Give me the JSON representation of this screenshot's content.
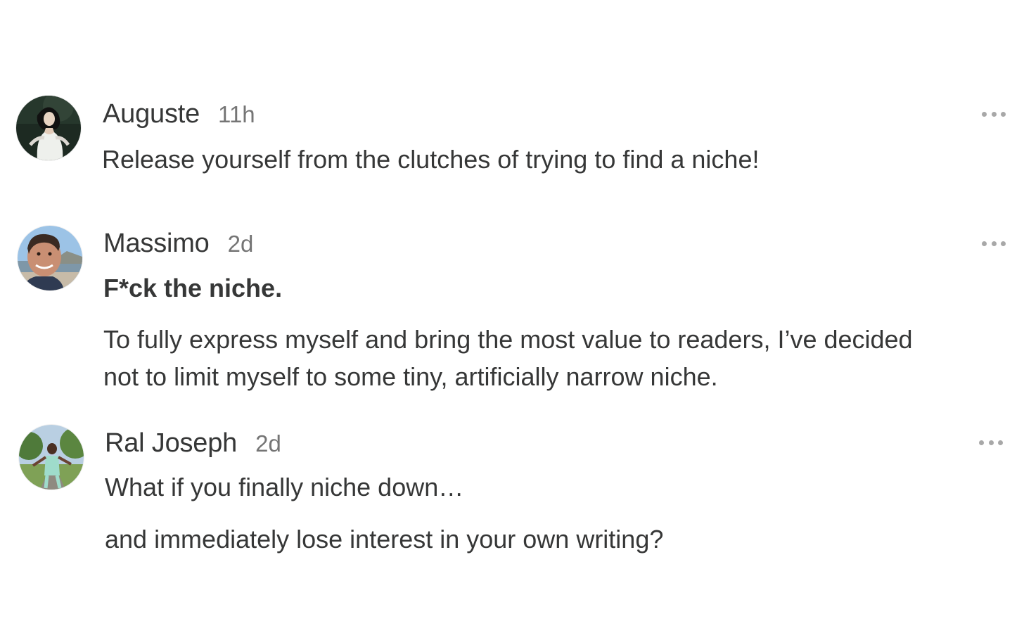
{
  "notes": [
    {
      "author": "Auguste",
      "time": "11h",
      "avatar": "avatar-woman-white-dress",
      "paragraphs": [
        "Release yourself from the clutches of trying to find a niche!"
      ]
    },
    {
      "author": "Massimo",
      "time": "2d",
      "avatar": "avatar-man-smiling-beach",
      "heading": "F*ck the niche.",
      "paragraphs": [
        "To fully express myself and bring the most value to readers, I’ve decided",
        "not to limit myself to some tiny, artificially narrow niche."
      ]
    },
    {
      "author": "Ral Joseph",
      "time": "2d",
      "avatar": "avatar-woman-park",
      "paragraphs": [
        "What if you finally niche down…",
        "and immediately lose interest in your own writing?"
      ]
    }
  ],
  "colors": {
    "text": "#363737",
    "muted": "#757575",
    "menu_dots": "#a8a8a8",
    "background": "#ffffff"
  },
  "icons": {
    "more_menu": "more-horizontal-icon"
  }
}
